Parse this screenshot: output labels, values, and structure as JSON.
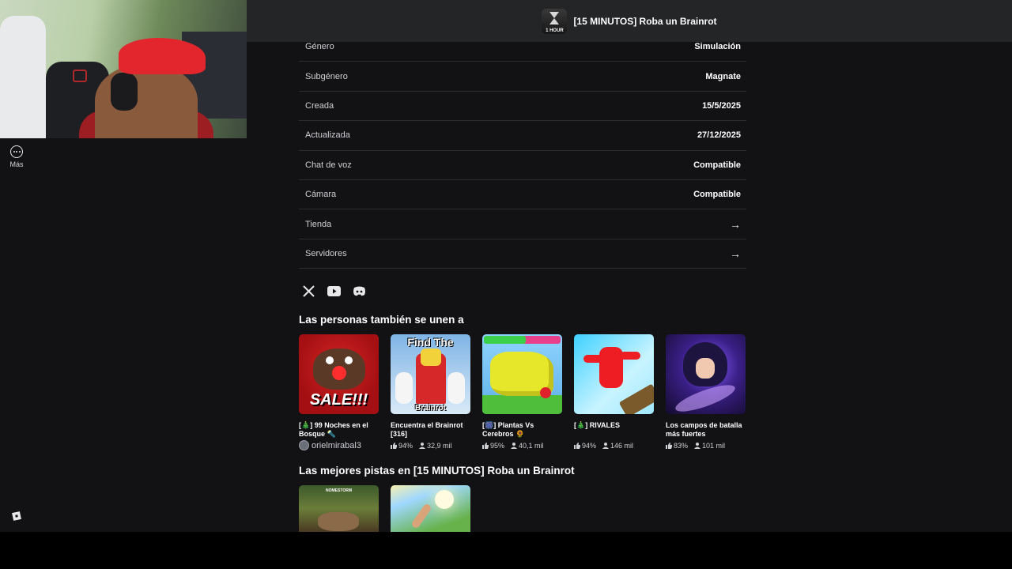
{
  "header": {
    "game_icon_text": "1 HOUR",
    "title": "[15 MINUTOS] Roba un Brainrot"
  },
  "sidebar": {
    "more_label": "Más"
  },
  "details": [
    {
      "key": "Género",
      "value": "Simulación"
    },
    {
      "key": "Subgénero",
      "value": "Magnate"
    },
    {
      "key": "Creada",
      "value": "15/5/2025"
    },
    {
      "key": "Actualizada",
      "value": "27/12/2025"
    },
    {
      "key": "Chat de voz",
      "value": "Compatible"
    },
    {
      "key": "Cámara",
      "value": "Compatible"
    },
    {
      "key": "Tienda",
      "value": "→"
    },
    {
      "key": "Servidores",
      "value": "→"
    }
  ],
  "socials": [
    "x-icon",
    "youtube-icon",
    "discord-icon"
  ],
  "also_join": {
    "title": "Las personas también se unen a",
    "games": [
      {
        "name": "[🎄] 99 Noches en el Bosque 🔦",
        "creator": "orielmirabal3",
        "thumb_text": "SALE!!!"
      },
      {
        "name": "Encuentra el Brainrot [316]",
        "rating": "94%",
        "players": "32,9 mil",
        "thumb_title": "Find The",
        "thumb_sub": "Brainrot"
      },
      {
        "name": "[🎆] Plantas Vs Cerebros 🌻",
        "rating": "95%",
        "players": "40,1 mil"
      },
      {
        "name": "[🎄] RIVALES",
        "rating": "94%",
        "players": "146 mil"
      },
      {
        "name": "Los campos de batalla más fuertes",
        "rating": "83%",
        "players": "101 mil"
      }
    ]
  },
  "best_tracks": {
    "title": "Las mejores pistas en [15 MINUTOS] Roba un Brainrot",
    "track1_label": "NOMESTORM"
  },
  "colors": {
    "background": "#121215",
    "header": "#232527",
    "divider": "#2c2d31"
  }
}
